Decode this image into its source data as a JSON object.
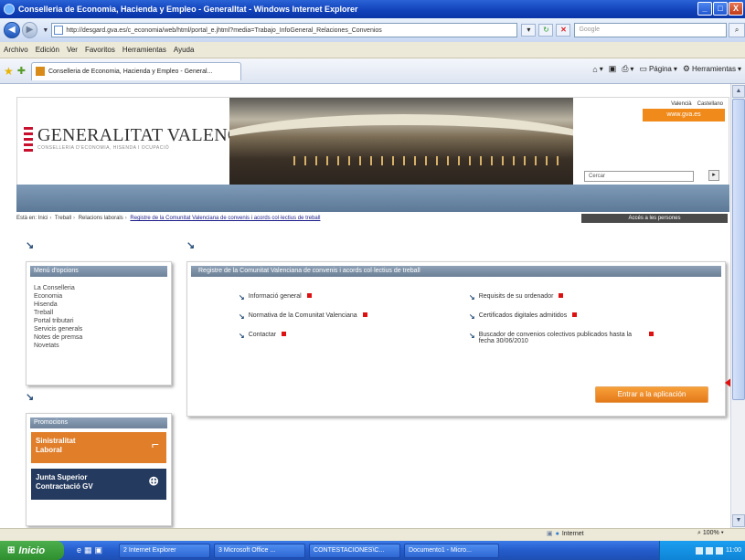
{
  "window": {
    "title": "Conselleria de Economia, Hacienda y Empleo - GeneralItat - Windows Internet Explorer",
    "buttons": {
      "minimize": "_",
      "maximize": "□",
      "close": "X"
    }
  },
  "addressbar": {
    "url": "http://desgard.gva.es/c_economia/web/html/portal_e.jhtml?media=Trabajo_InfoGeneral_Relaciones_Convenios",
    "search_placeholder": "Google"
  },
  "menubar": {
    "items": [
      "Archivo",
      "Edición",
      "Ver",
      "Favoritos",
      "Herramientas",
      "Ayuda"
    ]
  },
  "tabs": {
    "active_label": "Conselleria de Economia, Hacienda y Empleo - General...",
    "tools": {
      "page": "Página",
      "tools": "Herramientas"
    }
  },
  "site": {
    "logo_title": "GENERALITAT VALENCIANA",
    "logo_subtitle": "CONSELLERIA D'ECONOMIA, HISENDA I OCUPACIÓ",
    "top_links": [
      "Valencià",
      "Castellano"
    ],
    "gva_button": "www.gva.es",
    "search_value": "Cercar",
    "breadcrumb": [
      "Està en: Inici",
      "Treball",
      "Relacions laborals"
    ],
    "breadcrumb_current": "Registre de la Comunitat Valenciana de convenis i acords col·lectius de treball",
    "access_label": "Accés a les persones",
    "left_menu": {
      "title": "Menú d'opcions",
      "items": [
        "La Conselleria",
        "Economia",
        "Hisenda",
        "Treball",
        "Portal tributari",
        "Servicis generals",
        "Notes de premsa",
        "Novetats"
      ]
    },
    "promotions": {
      "title": "Promocions",
      "items": [
        {
          "line1": "Sinistralitat",
          "line2": "Laboral"
        },
        {
          "line1": "Junta Superior",
          "line2": "Contractació GV"
        }
      ]
    },
    "main": {
      "title": "Registre de la Comunitat Valenciana de convenis i acords col·lectius de treball",
      "left_links": [
        "Informació general",
        "Normativa de la Comunitat Valenciana",
        "Contactar"
      ],
      "right_links": [
        "Requisits de su ordenador",
        "Certificados digitales admitidos",
        "Buscador de convenios colectivos publicados hasta la fecha 30/06/2010"
      ],
      "enter_button": "Entrar a la aplicación"
    }
  },
  "statusbar": {
    "zone": "Internet",
    "zoom": "100%"
  },
  "taskbar": {
    "start": "Inicio",
    "tasks": [
      "2 Internet Explorer",
      "3 Microsoft Office ...",
      "CONTESTACIONES\\C...",
      "Documento1 - Micro..."
    ],
    "clock": "11:00"
  }
}
